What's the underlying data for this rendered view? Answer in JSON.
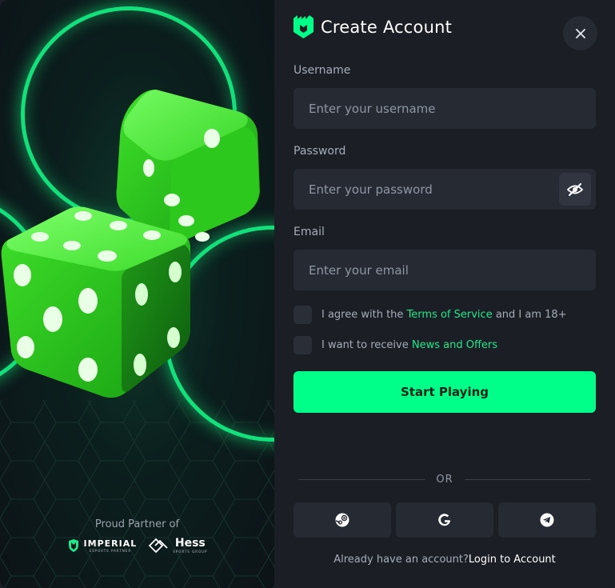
{
  "hero": {
    "partner_label": "Proud Partner of",
    "partner_1": {
      "name": "IMPERIAL",
      "tagline": "ESPORTS PARTNER"
    },
    "partner_2": {
      "name": "Hess",
      "tagline": "SPORTS GROUP"
    }
  },
  "form": {
    "title": "Create Account",
    "username": {
      "label": "Username",
      "placeholder": "Enter your username",
      "value": ""
    },
    "password": {
      "label": "Password",
      "placeholder": "Enter your password",
      "value": ""
    },
    "email": {
      "label": "Email",
      "placeholder": "Enter your email",
      "value": ""
    },
    "terms": {
      "prefix": "I agree with the",
      "link": "Terms of Service",
      "suffix": "and I am 18+",
      "checked": false
    },
    "news": {
      "prefix": "I want to receive",
      "link": "News and Offers",
      "checked": false
    },
    "submit_label": "Start Playing",
    "or_label": "OR",
    "social": [
      "steam-icon",
      "google-icon",
      "telegram-icon"
    ],
    "login_prompt": "Already have an account?",
    "login_link": "Login to Account"
  },
  "colors": {
    "accent": "#00ff88",
    "panel": "#1b1e25",
    "input": "#262a33",
    "ring": "#13e07a"
  }
}
